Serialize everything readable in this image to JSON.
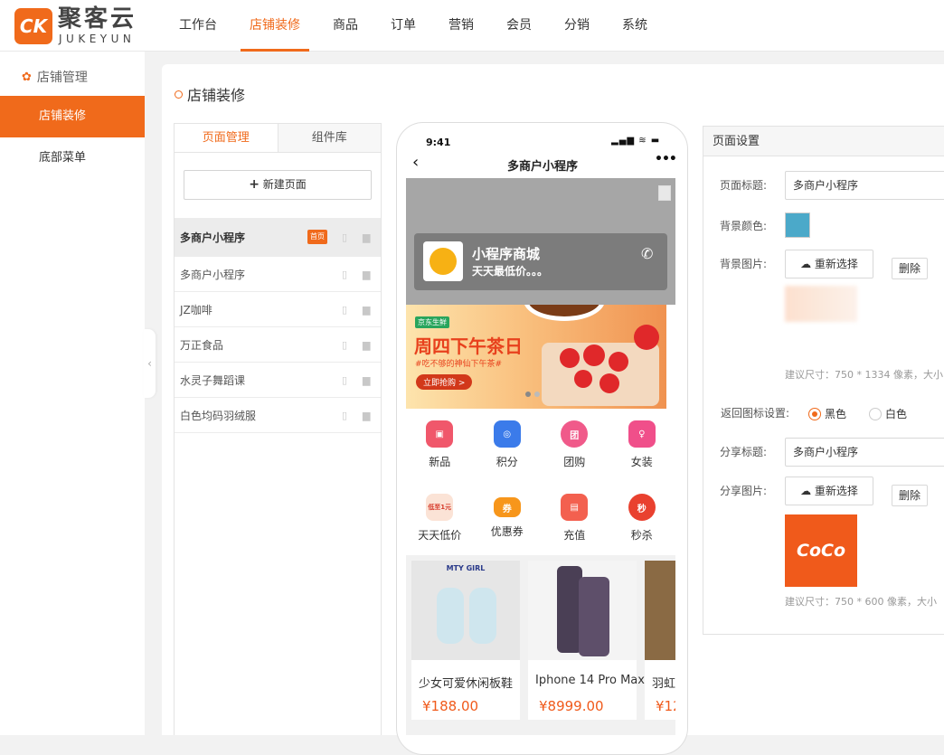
{
  "brand": {
    "logo_mark": "CK",
    "name_cn": "聚客云",
    "name_en": "JUKEYUN"
  },
  "nav": {
    "items": [
      "工作台",
      "店铺装修",
      "商品",
      "订单",
      "营销",
      "会员",
      "分销",
      "系统"
    ],
    "active": "店铺装修"
  },
  "sidebar": {
    "group_label": "店铺管理",
    "items": [
      {
        "label": "店铺装修",
        "active": true
      },
      {
        "label": "底部菜单",
        "active": false
      }
    ]
  },
  "page": {
    "title": "店铺装修"
  },
  "left_panel": {
    "tabs": [
      "页面管理",
      "组件库"
    ],
    "new_page_label": "新建页面",
    "pages": [
      {
        "name": "多商户小程序",
        "badge": "首页"
      },
      {
        "name": "多商户小程序"
      },
      {
        "name": "JZ咖啡"
      },
      {
        "name": "万正食品"
      },
      {
        "name": "水灵子舞蹈课"
      },
      {
        "name": "白色均码羽绒服"
      }
    ]
  },
  "phone": {
    "time": "9:41",
    "title": "多商户小程序",
    "store": {
      "name": "小程序商城",
      "subtitle": "天天最低价。。。"
    },
    "promo": {
      "tag": "京东生鲜",
      "headline": "周四下午茶日",
      "sub": "#吃不够的神仙下午茶#",
      "button": "立即抢购 >"
    },
    "grid_row1": [
      {
        "label": "新品",
        "color": "#f0576b",
        "glyph": "▣"
      },
      {
        "label": "积分",
        "color": "#3b7bea",
        "glyph": "◎"
      },
      {
        "label": "团购",
        "color": "#f05a8a",
        "glyph": "团"
      },
      {
        "label": "女装",
        "color": "#f04f8a",
        "glyph": "♀"
      }
    ],
    "grid_row2": [
      {
        "label": "天天低价",
        "color": "#f7c9b5",
        "glyph": "低至1元"
      },
      {
        "label": "优惠券",
        "color": "#f7961b",
        "glyph": "券"
      },
      {
        "label": "充值",
        "color": "#f3604f",
        "glyph": "▤"
      },
      {
        "label": "秒杀",
        "color": "#e9412f",
        "glyph": "秒"
      }
    ],
    "products": [
      {
        "name": "少女可爱休闲板鞋",
        "price": "¥188.00",
        "img_text": "MTY GIRL"
      },
      {
        "name": "Iphone 14 Pro Max",
        "price": "¥8999.00"
      },
      {
        "name": "羽虹",
        "price": "¥12"
      }
    ]
  },
  "right_panel": {
    "header": "页面设置",
    "page_title_label": "页面标题:",
    "page_title_value": "多商户小程序",
    "bg_color_label": "背景颜色:",
    "bg_color": "#4ba9c9",
    "bg_image_label": "背景图片:",
    "reselect_label": "重新选择",
    "delete_label": "删除",
    "bg_hint": "建议尺寸：750 * 1334 像素，大小",
    "back_icon_label": "返回图标设置:",
    "back_icon_options": [
      "黑色",
      "白色"
    ],
    "back_icon_selected": "黑色",
    "share_title_label": "分享标题:",
    "share_title_value": "多商户小程序",
    "share_image_label": "分享图片:",
    "share_image_text": "CoCo",
    "share_hint": "建议尺寸：750 * 600 像素，大小"
  },
  "colors": {
    "accent": "#f06a1b"
  }
}
